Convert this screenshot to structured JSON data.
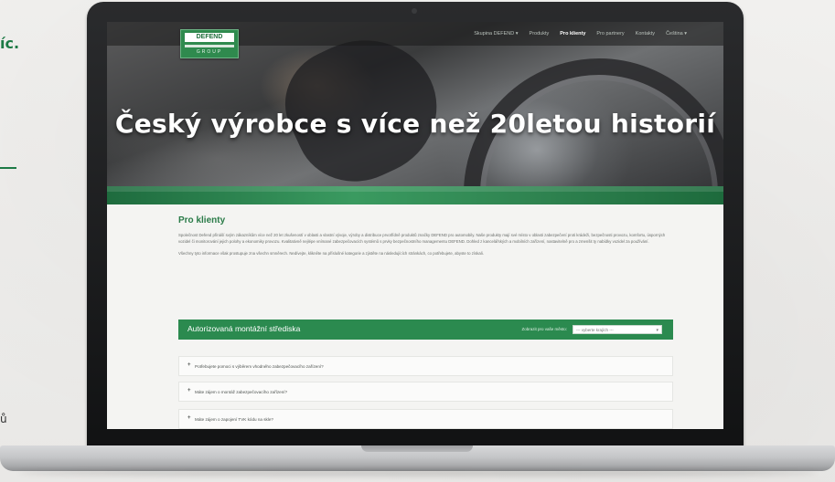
{
  "outside": {
    "title_fragment": "íc.",
    "text_fragment": "ů"
  },
  "site": {
    "logo_text": "DEFEND",
    "logo_subtext": "GROUP",
    "nav": [
      {
        "label": "Skupina DEFEND ▾"
      },
      {
        "label": "Produkty"
      },
      {
        "label": "Pro klienty"
      },
      {
        "label": "Pro partnery"
      },
      {
        "label": "Kontakty"
      },
      {
        "label": "Čeština ▾"
      }
    ],
    "hero_title": "Český výrobce s více než 20letou historií",
    "section_title": "Pro klienty",
    "paragraphs": [
      "Společnost Defend přináší svým zákazníkům více než 20 let zkušeností v oblasti a vlastní vývoje, výroby a distribuce prvotřídně produktů značky DEFEND pro automobily. Naše produkty mají své místo v oblasti zabezpečení proti krádeži, bezpečnosti provozu, komfortu, úsporných vozidel či monitorování jejich polohy a ekonomiky provozu. Kvalitativně nejlépe vnímané zabezpečovacích systémů s prvky bezpečnostního managementu DEFEND. Dohled z kancelářských a mobilních zařízení, nastavitelně pro a zmenšit ty nabídky vozidel za používání.",
      "Všechny tyto informace však prostupuje zna všechn smněrech. Nedívejte, klikněte na příslušné kategorie a zjistěte na následujících stránkách, co potřebujete, abyste to získali."
    ],
    "service_bar": {
      "title": "Autorizovaná montážní střediska",
      "select_label": "Zobrazit pro vaše město:",
      "select_value": "--- vyberte krajích ---"
    },
    "accordion": [
      {
        "label": "Potřebujete pomoci s výběrem vhodného zabezpečovacího zařízení?"
      },
      {
        "label": "Máte zájem o montáž zabezpečovacího zařízení?"
      },
      {
        "label": "Máte zájem o zapojení TVK kódu na skle?"
      }
    ]
  }
}
